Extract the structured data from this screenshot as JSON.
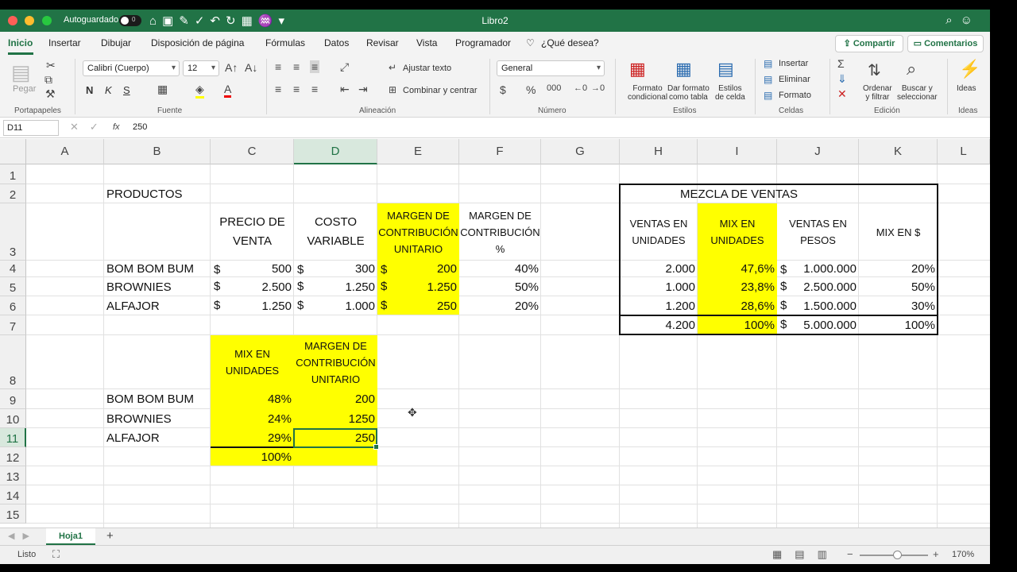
{
  "titlebar": {
    "autosave": "Autoguardado",
    "toggle": "0",
    "title": "Libro2"
  },
  "menu": {
    "items": [
      "Inicio",
      "Insertar",
      "Dibujar",
      "Disposición de página",
      "Fórmulas",
      "Datos",
      "Revisar",
      "Vista",
      "Programador",
      "¿Qué desea?"
    ],
    "share": "Compartir",
    "comments": "Comentarios"
  },
  "ribbon": {
    "paste": "Pegar",
    "font_name": "Calibri (Cuerpo)",
    "font_size": "12",
    "bold": "N",
    "italic": "K",
    "underline": "S",
    "wrap": "Ajustar texto",
    "merge": "Combinar y centrar",
    "number_format": "General",
    "cond_format": [
      "Formato",
      "condicional"
    ],
    "table_format": [
      "Dar formato",
      "como tabla"
    ],
    "cell_styles": [
      "Estilos",
      "de celda"
    ],
    "insert": "Insertar",
    "delete": "Eliminar",
    "format": "Formato",
    "sort": [
      "Ordenar",
      "y filtrar"
    ],
    "find": [
      "Buscar y",
      "seleccionar"
    ],
    "ideas": "Ideas",
    "groups": [
      "Portapapeles",
      "Fuente",
      "Alineación",
      "Número",
      "Estilos",
      "Celdas",
      "Edición",
      "Ideas"
    ]
  },
  "formula": {
    "namebox": "D11",
    "fx": "fx",
    "value": "250"
  },
  "grid": {
    "columns": [
      "A",
      "B",
      "C",
      "D",
      "E",
      "F",
      "G",
      "H",
      "I",
      "J",
      "K",
      "L"
    ],
    "rows": [
      "1",
      "2",
      "3",
      "4",
      "5",
      "6",
      "7",
      "8",
      "9",
      "10",
      "11",
      "12",
      "13",
      "14",
      "15"
    ],
    "selected_cell": "D11"
  },
  "sheet": {
    "b2": "PRODUCTOS",
    "c3": "PRECIO DE VENTA",
    "d3": "COSTO VARIABLE",
    "e3": "MARGEN DE CONTRIBUCIÓN UNITARIO",
    "f3": "MARGEN DE CONTRIBUCIÓN %",
    "products": [
      {
        "name": "BOM BOM BUM",
        "cur": "$",
        "price": "500",
        "cost": "300",
        "margin": "200",
        "pct": "40%"
      },
      {
        "name": "BROWNIES",
        "cur": "$",
        "price": "2.500",
        "cost": "1.250",
        "margin": "1.250",
        "pct": "50%"
      },
      {
        "name": "ALFAJOR",
        "cur": "$",
        "price": "1.250",
        "cost": "1.000",
        "margin": "250",
        "pct": "20%"
      }
    ],
    "mix_title": "MEZCLA DE VENTAS",
    "h3": "VENTAS EN UNIDADES",
    "i3": "MIX EN UNIDADES",
    "j3": "VENTAS EN PESOS",
    "k3": "MIX EN $",
    "mix": [
      {
        "units": "2.000",
        "mix_u": "47,6%",
        "cur": "$",
        "pesos": "1.000.000",
        "mix_p": "20%"
      },
      {
        "units": "1.000",
        "mix_u": "23,8%",
        "cur": "$",
        "pesos": "2.500.000",
        "mix_p": "50%"
      },
      {
        "units": "1.200",
        "mix_u": "28,6%",
        "cur": "$",
        "pesos": "1.500.000",
        "mix_p": "30%"
      }
    ],
    "mix_total": {
      "units": "4.200",
      "mix_u": "100%",
      "cur": "$",
      "pesos": "5.000.000",
      "mix_p": "100%"
    },
    "c8": "MIX EN UNIDADES",
    "d8": "MARGEN DE CONTRIBUCIÓN UNITARIO",
    "lower": [
      {
        "name": "BOM BOM BUM",
        "mix": "48%",
        "margin": "200"
      },
      {
        "name": "BROWNIES",
        "mix": "24%",
        "margin": "1250"
      },
      {
        "name": "ALFAJOR",
        "mix": "29%",
        "margin": "250"
      }
    ],
    "c12": "100%"
  },
  "tabs": {
    "sheet": "Hoja1",
    "add": "+"
  },
  "status": {
    "ready": "Listo",
    "zoom_value": "170%",
    "zoom_level": 0.55
  },
  "colors": {
    "accent": "#217346",
    "highlight": "#ffff00"
  }
}
